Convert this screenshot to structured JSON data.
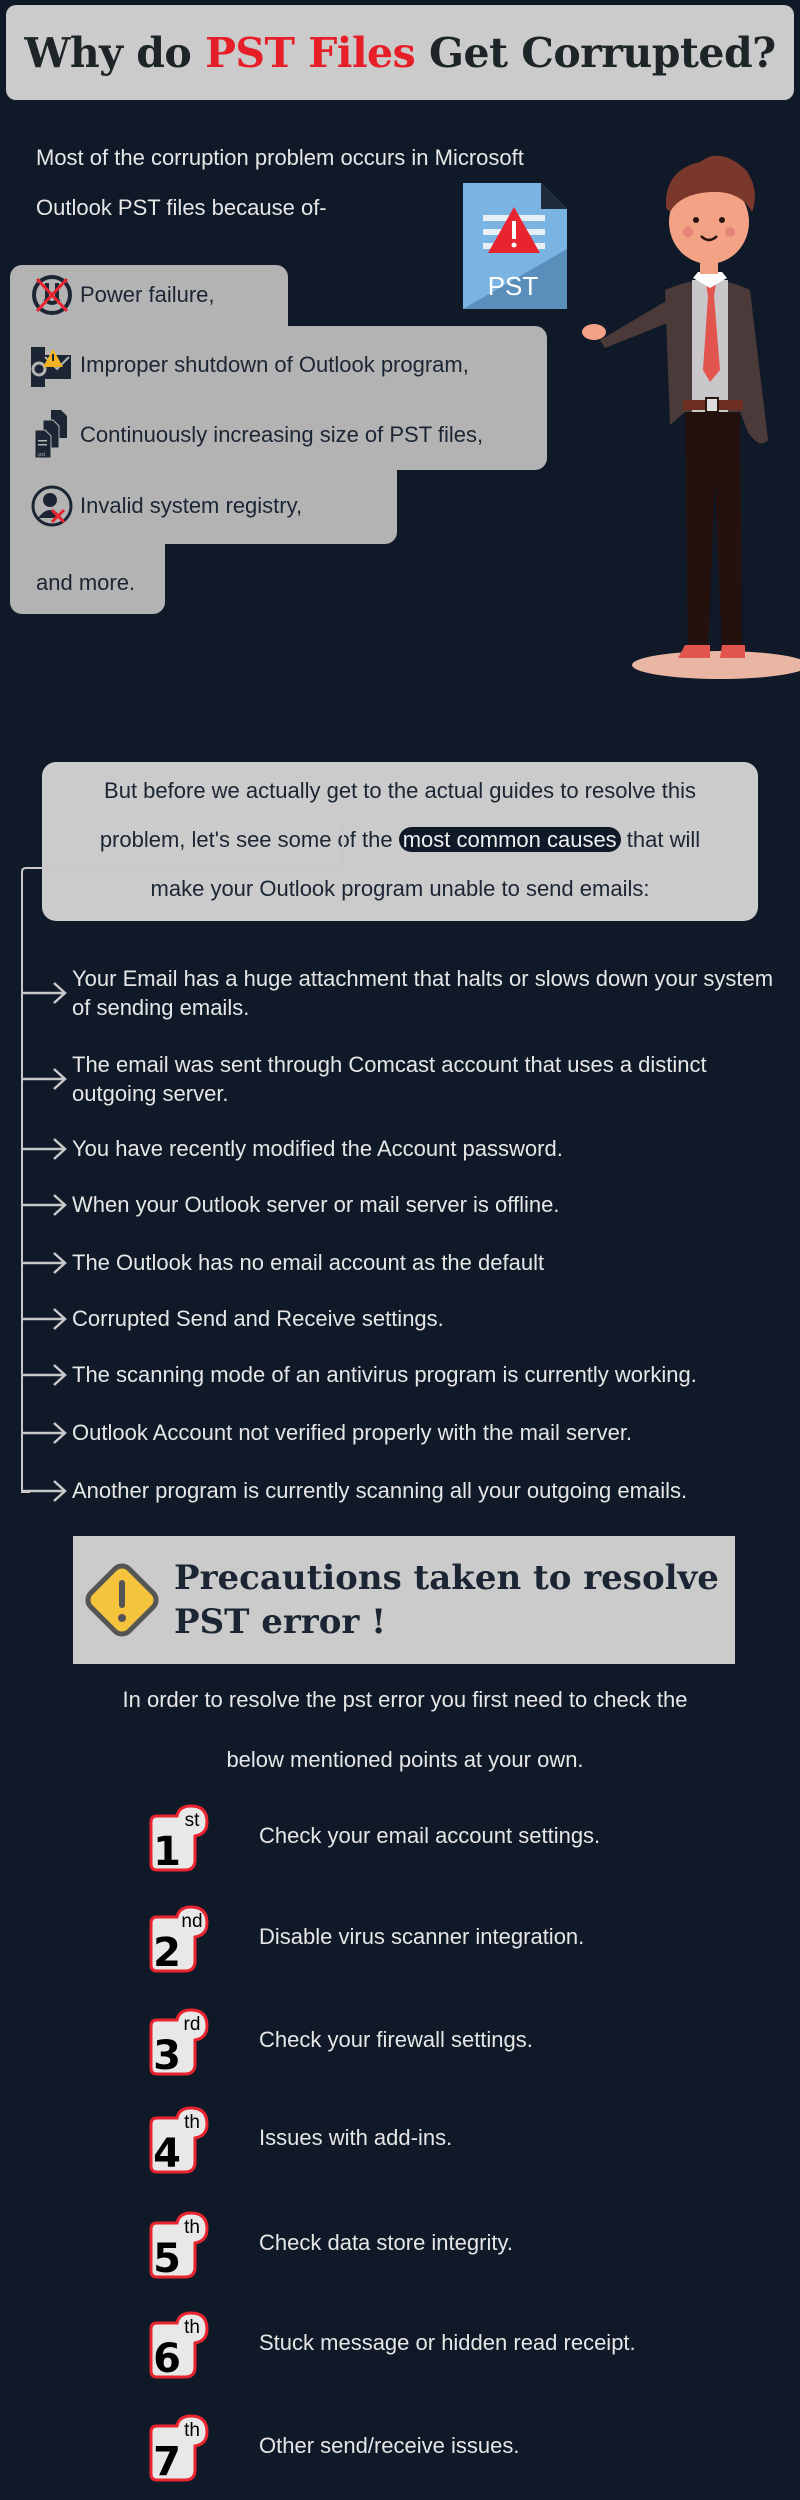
{
  "header": {
    "title_part1": "Why do ",
    "title_highlight": "PST Files",
    "title_part2": " Get Corrupted?",
    "highlight_color": "#e61e28"
  },
  "intro": {
    "line1": "Most of the corruption problem occurs in Microsoft",
    "line2": "Outlook PST files because of-"
  },
  "pst_file_icon": {
    "label": "PST",
    "icon": "pst-file-warning-icon"
  },
  "corruption_reasons": [
    {
      "icon": "power-failure-icon",
      "label": "Power failure,"
    },
    {
      "icon": "outlook-warning-icon",
      "label": "Improper shutdown of Outlook program,"
    },
    {
      "icon": "stacked-files-icon",
      "label": "Continuously increasing size of PST files,",
      "file_tag": ".pst"
    },
    {
      "icon": "invalid-user-icon",
      "label": "Invalid system registry,"
    },
    {
      "icon": null,
      "label": "and more."
    }
  ],
  "causes_intro": {
    "line1": "But before we actually get to the actual guides to resolve this",
    "line2_before": "problem, let's see some of the ",
    "line2_highlight": "most common causes",
    "line2_after": " that will",
    "line3": "make your Outlook program unable to send emails:"
  },
  "causes": [
    "Your Email has a huge attachment that halts or slows down your system of sending emails.",
    "The email was sent through Comcast account that uses a distinct outgoing server.",
    "You have recently modified the Account password.",
    "When your Outlook server or mail server is offline.",
    "The Outlook has no email account as the default",
    "Corrupted Send and Receive settings.",
    "The scanning mode of an antivirus program is currently working.",
    "Outlook Account not verified properly with the mail server.",
    "Another program is currently scanning all your outgoing emails."
  ],
  "precautions": {
    "title_line1": "Precautions taken to resolve",
    "title_line2": "PST error !",
    "intro_line1": "In order to resolve the pst error you first need to check the",
    "intro_line2": "below mentioned points at your own.",
    "steps": [
      {
        "num": "1",
        "suffix": "st",
        "text": "Check your email account settings."
      },
      {
        "num": "2",
        "suffix": "nd",
        "text": "Disable virus scanner integration."
      },
      {
        "num": "3",
        "suffix": "rd",
        "text": "Check your firewall settings."
      },
      {
        "num": "4",
        "suffix": "th",
        "text": "Issues with add-ins."
      },
      {
        "num": "5",
        "suffix": "th",
        "text": "Check data store integrity."
      },
      {
        "num": "6",
        "suffix": "th",
        "text": "Stuck message or hidden read receipt."
      },
      {
        "num": "7",
        "suffix": "th",
        "text": "Other send/receive issues."
      }
    ]
  }
}
